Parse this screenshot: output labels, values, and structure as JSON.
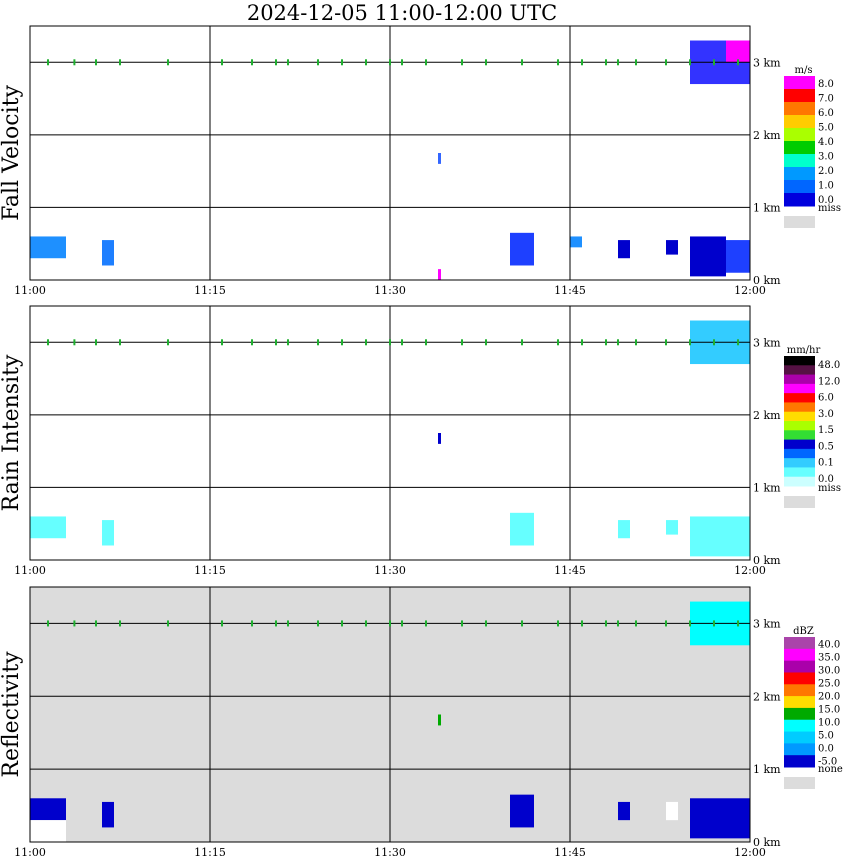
{
  "title": "2024-12-05  11:00-12:00 UTC",
  "time_ticks": [
    "11:00",
    "11:15",
    "11:30",
    "11:45",
    "12:00"
  ],
  "height_ticks": [
    "0 km",
    "1 km",
    "2 km",
    "3 km"
  ],
  "colors": {
    "frame": "#000000",
    "background": "#ffffff",
    "missing": "#dcdcdc",
    "marker": "#20b030"
  },
  "chart_data": [
    {
      "type": "heatmap",
      "title": "Fall Velocity",
      "xlabel": "",
      "ylabel": "Fall Velocity",
      "xlim": [
        "11:00",
        "12:00"
      ],
      "ylim": [
        0,
        3.5
      ],
      "grid": true,
      "background": "#ffffff",
      "colorbar": {
        "unit": "m/s",
        "placement": "right",
        "labels": [
          "8.0",
          "7.0",
          "6.0",
          "5.0",
          "4.0",
          "3.0",
          "2.0",
          "1.0",
          "0.0"
        ],
        "colors": [
          "#ff00ff",
          "#ff0000",
          "#ff7700",
          "#ffcc00",
          "#aaff00",
          "#00cc00",
          "#00ffcc",
          "#0099ff",
          "#0066ff",
          "#0000dd"
        ],
        "missing_label": "miss",
        "missing_color": "#dcdcdc"
      },
      "regions": [
        {
          "t_start": "11:00",
          "t_end": "11:03",
          "h_min": 0.3,
          "h_max": 0.6,
          "color": "#1e90ff"
        },
        {
          "t_start": "11:06",
          "t_end": "11:07",
          "h_min": 0.2,
          "h_max": 0.55,
          "color": "#1e7fff"
        },
        {
          "t_start": "11:34",
          "t_end": "11:34",
          "h_min": 0.0,
          "h_max": 0.15,
          "color": "#ff00ff"
        },
        {
          "t_start": "11:34",
          "t_end": "11:34",
          "h_min": 1.6,
          "h_max": 1.75,
          "color": "#3366ff"
        },
        {
          "t_start": "11:40",
          "t_end": "11:42",
          "h_min": 0.2,
          "h_max": 0.65,
          "color": "#1e40ff"
        },
        {
          "t_start": "11:45",
          "t_end": "11:46",
          "h_min": 0.45,
          "h_max": 0.6,
          "color": "#1e90ff"
        },
        {
          "t_start": "11:49",
          "t_end": "11:50",
          "h_min": 0.3,
          "h_max": 0.55,
          "color": "#0000cc"
        },
        {
          "t_start": "11:53",
          "t_end": "11:54",
          "h_min": 0.35,
          "h_max": 0.55,
          "color": "#0000cc"
        },
        {
          "t_start": "11:55",
          "t_end": "11:58",
          "h_min": 0.05,
          "h_max": 0.6,
          "color": "#0000cc"
        },
        {
          "t_start": "11:58",
          "t_end": "12:00",
          "h_min": 0.1,
          "h_max": 0.55,
          "color": "#1e40ff"
        },
        {
          "t_start": "11:55",
          "t_end": "12:00",
          "h_min": 2.7,
          "h_max": 3.3,
          "color": "#3333ff"
        },
        {
          "t_start": "11:58",
          "t_end": "12:00",
          "h_min": 3.0,
          "h_max": 3.3,
          "color": "#ff00ff"
        }
      ]
    },
    {
      "type": "heatmap",
      "title": "Rain Intensity",
      "xlabel": "",
      "ylabel": "Rain Intensity",
      "xlim": [
        "11:00",
        "12:00"
      ],
      "ylim": [
        0,
        3.5
      ],
      "grid": true,
      "background": "#ffffff",
      "colorbar": {
        "unit": "mm/hr",
        "placement": "right",
        "labels": [
          "48.0",
          "12.0",
          "6.0",
          "3.0",
          "1.5",
          "0.5",
          "0.1",
          "0.0"
        ],
        "colors": [
          "#000000",
          "#551144",
          "#aa00aa",
          "#ff00ff",
          "#ff0000",
          "#ff7700",
          "#ffdd00",
          "#aaff00",
          "#33dd33",
          "#0000cc",
          "#0066ff",
          "#33ccff",
          "#66ffff",
          "#ccffff"
        ],
        "missing_label": "miss",
        "missing_color": "#dcdcdc"
      },
      "regions": [
        {
          "t_start": "11:00",
          "t_end": "11:03",
          "h_min": 0.3,
          "h_max": 0.6,
          "color": "#66ffff"
        },
        {
          "t_start": "11:06",
          "t_end": "11:07",
          "h_min": 0.2,
          "h_max": 0.55,
          "color": "#66ffff"
        },
        {
          "t_start": "11:34",
          "t_end": "11:34",
          "h_min": 1.6,
          "h_max": 1.75,
          "color": "#0000cc"
        },
        {
          "t_start": "11:40",
          "t_end": "11:42",
          "h_min": 0.2,
          "h_max": 0.65,
          "color": "#66ffff"
        },
        {
          "t_start": "11:49",
          "t_end": "11:50",
          "h_min": 0.3,
          "h_max": 0.55,
          "color": "#66ffff"
        },
        {
          "t_start": "11:53",
          "t_end": "11:54",
          "h_min": 0.35,
          "h_max": 0.55,
          "color": "#66ffff"
        },
        {
          "t_start": "11:55",
          "t_end": "12:00",
          "h_min": 0.05,
          "h_max": 0.6,
          "color": "#66ffff"
        },
        {
          "t_start": "11:55",
          "t_end": "12:00",
          "h_min": 2.7,
          "h_max": 3.3,
          "color": "#33ccff"
        }
      ]
    },
    {
      "type": "heatmap",
      "title": "Reflectivity",
      "xlabel": "",
      "ylabel": "Reflectivity",
      "xlim": [
        "11:00",
        "12:00"
      ],
      "ylim": [
        0,
        3.5
      ],
      "grid": true,
      "background": "#dcdcdc",
      "colorbar": {
        "unit": "dBZ",
        "placement": "right",
        "labels": [
          "40.0",
          "35.0",
          "30.0",
          "25.0",
          "20.0",
          "15.0",
          "10.0",
          "5.0",
          "0.0",
          "-5.0"
        ],
        "colors": [
          "#aa44aa",
          "#ff00ff",
          "#aa00aa",
          "#ff0000",
          "#ff7700",
          "#ffdd00",
          "#00aa00",
          "#00ffff",
          "#00ccff",
          "#0099ff",
          "#0000cc"
        ],
        "missing_label": "none",
        "missing_color": "#dcdcdc"
      },
      "regions": [
        {
          "t_start": "11:00",
          "t_end": "11:03",
          "h_min": 0.3,
          "h_max": 0.6,
          "color": "#0000cc"
        },
        {
          "t_start": "11:00",
          "t_end": "11:03",
          "h_min": 0.0,
          "h_max": 0.3,
          "color": "#ffffff"
        },
        {
          "t_start": "11:06",
          "t_end": "11:07",
          "h_min": 0.2,
          "h_max": 0.55,
          "color": "#0000cc"
        },
        {
          "t_start": "11:34",
          "t_end": "11:34",
          "h_min": 1.6,
          "h_max": 1.75,
          "color": "#00aa00"
        },
        {
          "t_start": "11:40",
          "t_end": "11:42",
          "h_min": 0.2,
          "h_max": 0.65,
          "color": "#0000cc"
        },
        {
          "t_start": "11:49",
          "t_end": "11:50",
          "h_min": 0.3,
          "h_max": 0.55,
          "color": "#0000cc"
        },
        {
          "t_start": "11:53",
          "t_end": "11:54",
          "h_min": 0.3,
          "h_max": 0.55,
          "color": "#ffffff"
        },
        {
          "t_start": "11:55",
          "t_end": "12:00",
          "h_min": 0.05,
          "h_max": 0.6,
          "color": "#0000cc"
        },
        {
          "t_start": "11:55",
          "t_end": "12:00",
          "h_min": 2.7,
          "h_max": 3.3,
          "color": "#00ffff"
        }
      ]
    }
  ]
}
